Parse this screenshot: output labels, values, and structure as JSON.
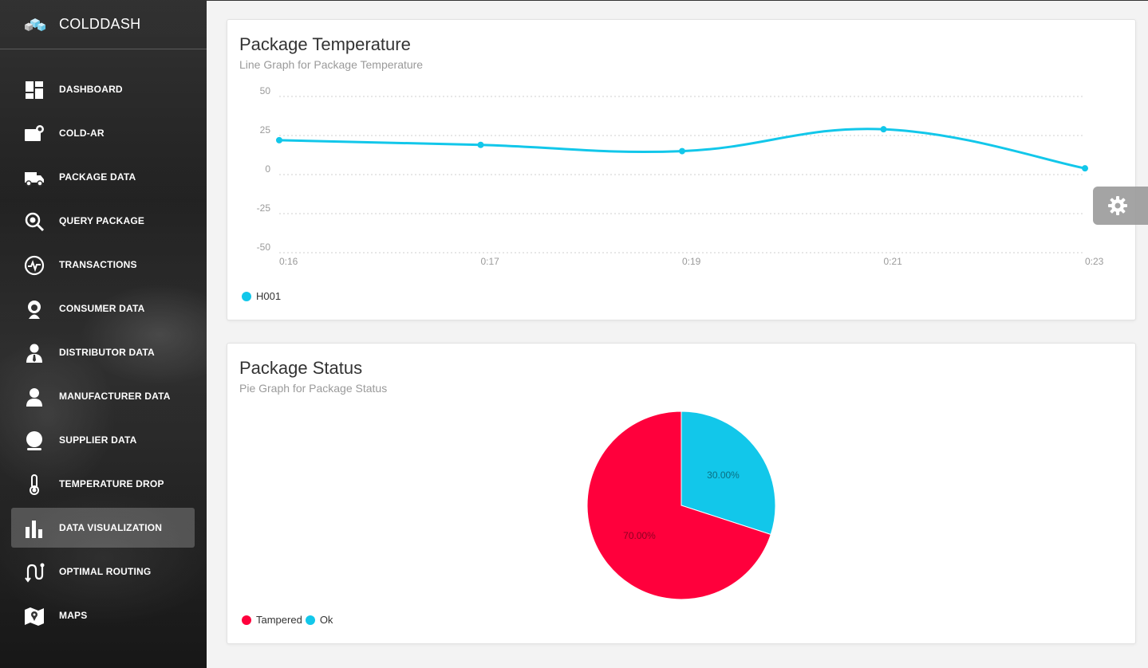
{
  "brand": {
    "name": "COLDDASH",
    "logo_icon": "cubes-icon"
  },
  "nav": [
    {
      "label": "DASHBOARD",
      "icon": "dashboard-icon",
      "active": false
    },
    {
      "label": "COLD-AR",
      "icon": "camera-icon",
      "active": false
    },
    {
      "label": "PACKAGE DATA",
      "icon": "truck-icon",
      "active": false
    },
    {
      "label": "QUERY PACKAGE",
      "icon": "search-icon",
      "active": false
    },
    {
      "label": "TRANSACTIONS",
      "icon": "pulse-icon",
      "active": false
    },
    {
      "label": "CONSUMER DATA",
      "icon": "user-icon",
      "active": false
    },
    {
      "label": "DISTRIBUTOR DATA",
      "icon": "user-tie-icon",
      "active": false
    },
    {
      "label": "MANUFACTURER DATA",
      "icon": "person-icon",
      "active": false
    },
    {
      "label": "SUPPLIER DATA",
      "icon": "person-circle-icon",
      "active": false
    },
    {
      "label": "TEMPERATURE DROP",
      "icon": "thermometer-icon",
      "active": false
    },
    {
      "label": "DATA VISUALIZATION",
      "icon": "bar-chart-icon",
      "active": true
    },
    {
      "label": "OPTIMAL ROUTING",
      "icon": "route-icon",
      "active": false
    },
    {
      "label": "MAPS",
      "icon": "map-icon",
      "active": false
    }
  ],
  "temperature_card": {
    "title": "Package Temperature",
    "subtitle": "Line Graph for Package Temperature"
  },
  "status_card": {
    "title": "Package Status",
    "subtitle": "Pie Graph for Package Status"
  },
  "chart_data": [
    {
      "type": "line",
      "x": [
        "0:16",
        "0:17",
        "0:19",
        "0:21",
        "0:23"
      ],
      "series": [
        {
          "name": "H001",
          "values": [
            22,
            19,
            15,
            29,
            4
          ],
          "color": "#12c7ea"
        }
      ],
      "ylim": [
        -50,
        50
      ],
      "yticks": [
        50,
        25,
        0,
        -25,
        -50
      ],
      "grid": true,
      "legend": "bottom-left"
    },
    {
      "type": "pie",
      "slices": [
        {
          "name": "Tampered",
          "value": 70,
          "label": "70.00%",
          "color": "#ff003c"
        },
        {
          "name": "Ok",
          "value": 30,
          "label": "30.00%",
          "color": "#12c7ea"
        }
      ],
      "legend": "bottom-left"
    }
  ],
  "settings": {
    "icon": "gear-icon"
  }
}
